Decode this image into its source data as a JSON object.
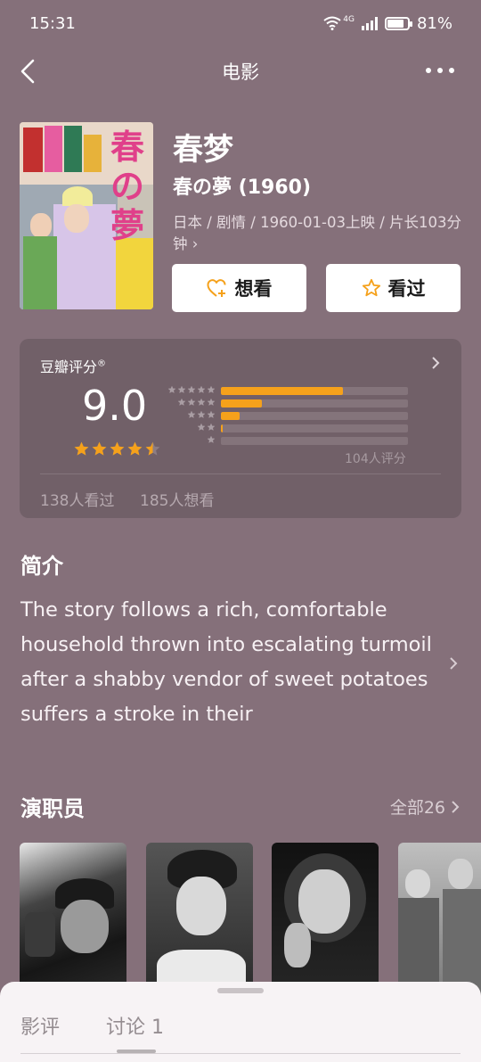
{
  "status_bar": {
    "time": "15:31",
    "network": "4G",
    "battery": "81%",
    "battery_level": 0.81
  },
  "nav": {
    "title": "电影",
    "icons": [
      "back-arrow-icon",
      "more-icon"
    ]
  },
  "movie": {
    "title": "春梦",
    "original_title": "春の夢 (1960)",
    "meta": "日本 / 剧情 / 1960-01-03上映 / 片长103分钟",
    "meta_arrow": "›",
    "poster_title": "春の夢"
  },
  "actions": {
    "want_label": "想看",
    "seen_label": "看过",
    "want_icon": "heart-plus-icon",
    "seen_icon": "star-icon",
    "accent_color": "#f5a11b"
  },
  "rating": {
    "label": "豆瓣评分",
    "mark": "®",
    "score": "9.0",
    "stars": 4.5,
    "distribution": [
      {
        "stars": 5,
        "fraction": 0.65
      },
      {
        "stars": 4,
        "fraction": 0.22
      },
      {
        "stars": 3,
        "fraction": 0.1
      },
      {
        "stars": 2,
        "fraction": 0.01
      },
      {
        "stars": 1,
        "fraction": 0.0
      }
    ],
    "count": "104人评分",
    "seen": "138人看过",
    "wish": "185人想看"
  },
  "synopsis": {
    "heading": "简介",
    "text": "The story follows a rich, comfortable household thrown into escalating turmoil after a shabby vendor of sweet potatoes suffers a stroke in their"
  },
  "cast": {
    "heading": "演职员",
    "all_label": "全部26"
  },
  "bottom_sheet": {
    "tabs": [
      "影评",
      "讨论 1"
    ]
  }
}
